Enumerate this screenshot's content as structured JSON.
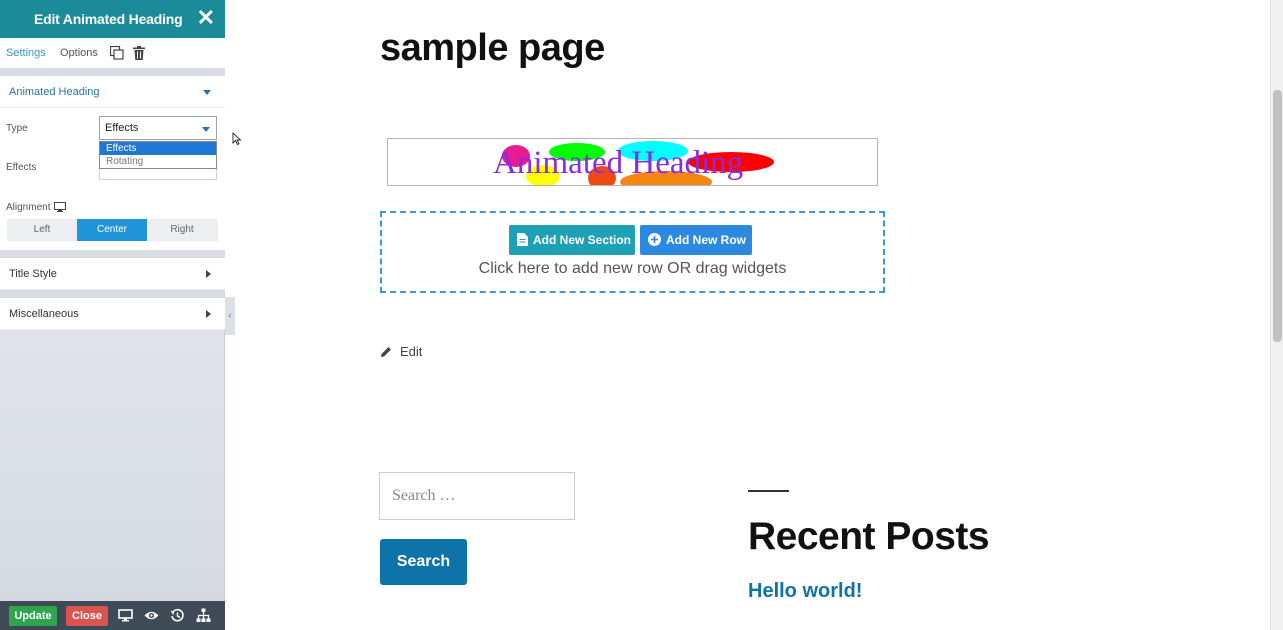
{
  "panel": {
    "title": "Edit Animated Heading",
    "close_glyph": "✕",
    "tabs": [
      "Settings",
      "Options"
    ],
    "icons": [
      "duplicate-icon",
      "trash-icon"
    ],
    "sections": {
      "animated_heading": "Animated Heading",
      "title_style": "Title Style",
      "miscellaneous": "Miscellaneous"
    },
    "fields": {
      "type_label": "Type",
      "type_value": "Effects",
      "type_options": [
        "Effects",
        "Rotating"
      ],
      "effects_label": "Effects",
      "alignment_label": "Alignment",
      "alignment_options": [
        "Left",
        "Center",
        "Right"
      ],
      "alignment_selected": "Center"
    },
    "collapse_glyph": "‹",
    "footer": {
      "update": "Update",
      "close": "Close",
      "icons": [
        "desktop-icon",
        "eye-icon",
        "history-icon",
        "sitemap-icon"
      ]
    }
  },
  "page": {
    "title": "sample page",
    "animated_heading_text": "Animated Heading",
    "blob_colors": [
      "#e9198e",
      "#00ff00",
      "#00ffff",
      "#ff0000",
      "#ffff00",
      "#f04a14",
      "#f58612"
    ],
    "add_section": "Add New Section",
    "add_row": "Add New Row",
    "drop_zone_text": "Click here to add new row OR drag widgets",
    "edit_link": "Edit",
    "search_placeholder": "Search …",
    "search_button": "Search",
    "recent_posts_title": "Recent Posts",
    "recent_post_link": "Hello world!"
  },
  "colors": {
    "panel_header": "#1b8a99",
    "accent_blue": "#1e95d9",
    "update_green": "#2ea44f",
    "close_red": "#d9534f",
    "link_blue": "#0e73a8"
  }
}
